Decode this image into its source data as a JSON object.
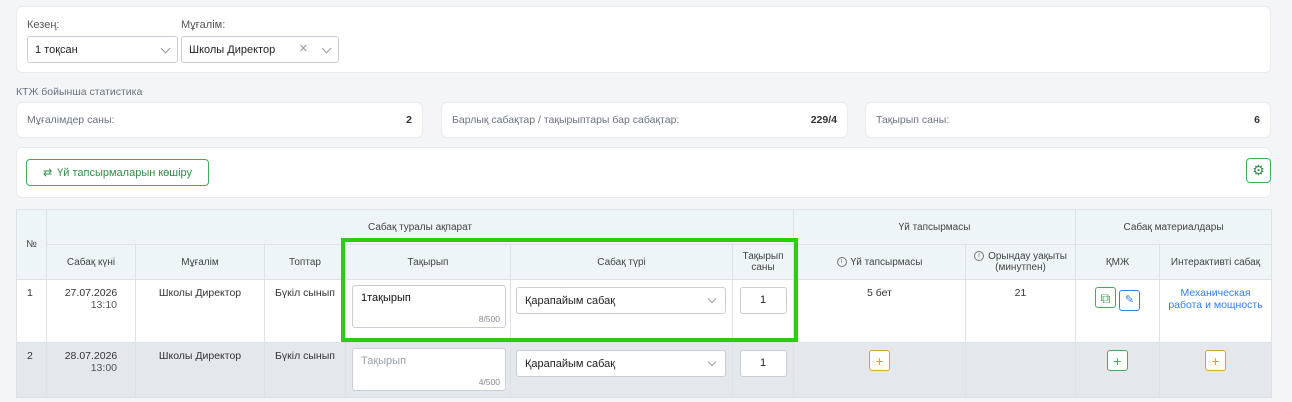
{
  "filters": {
    "period_label": "Кезең:",
    "period_value": "1 тоқсан",
    "teacher_label": "Мұғалім:",
    "teacher_value": "Школы Директор"
  },
  "stats": {
    "title": "КТЖ бойынша статистика",
    "teachers_label": "Мұғалімдер саны:",
    "teachers_value": "2",
    "lessons_label": "Барлық сабақтар / тақырыптары бар сабақтар:",
    "lessons_value": "229/4",
    "topics_label": "Тақырып саны:",
    "topics_value": "6"
  },
  "toolbar": {
    "copy_button": "Үй тапсырмаларын көшіру"
  },
  "table": {
    "groups": {
      "num": "№",
      "lesson_info": "Сабақ туралы ақпарат",
      "homework": "Үй тапсырмасы",
      "materials": "Сабақ материалдары"
    },
    "columns": {
      "date": "Сабақ күні",
      "teacher": "Мұғалім",
      "groups": "Топтар",
      "topic": "Тақырып",
      "type": "Сабақ түрі",
      "topic_count": "Тақырып саны",
      "homework": "Үй тапсырмасы",
      "duration": "Орындау уақыты (минутпен)",
      "kmzh": "ҚМЖ",
      "interactive": "Интерактивті сабақ"
    },
    "rows": [
      {
        "num": "1",
        "date": "27.07.2026",
        "time": "13:10",
        "teacher": "Школы Директор",
        "groups": "Бүкіл сынып",
        "topic": "1тақырып",
        "topic_counter": "8/500",
        "type": "Қарапайым сабақ",
        "qty": "1",
        "homework": "5 бет",
        "duration": "21",
        "interactive": "Механическая работа и мощность"
      },
      {
        "num": "2",
        "date": "28.07.2026",
        "time": "13:00",
        "teacher": "Школы Директор",
        "groups": "Бүкіл сынып",
        "topic_placeholder": "Тақырып",
        "topic_counter": "4/500",
        "type": "Қарапайым сабақ",
        "qty": "1"
      }
    ]
  }
}
